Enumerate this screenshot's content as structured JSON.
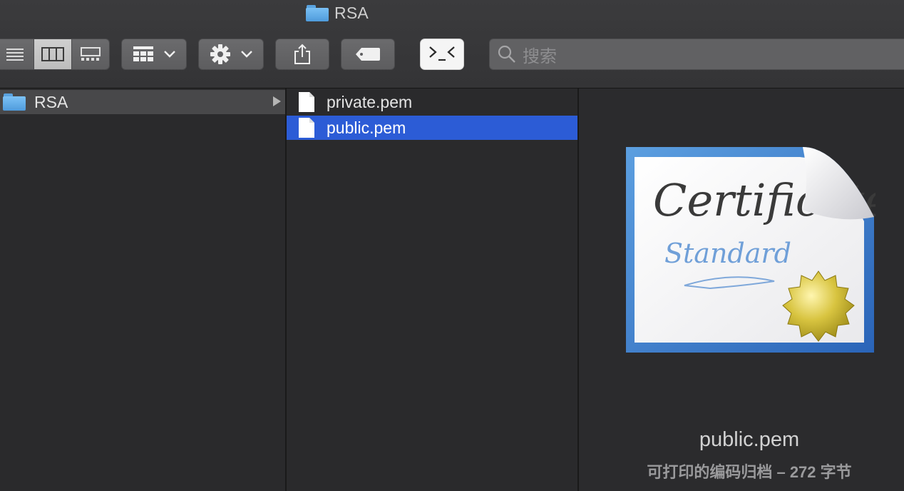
{
  "window": {
    "title": "RSA"
  },
  "toolbar": {
    "view_modes": [
      "list-view",
      "column-view",
      "gallery-view"
    ],
    "active_view": "column-view",
    "group_button": "group-by",
    "action_button": "action-menu",
    "share_button": "share",
    "tags_button": "tags",
    "terminal_button": "terminal",
    "search": {
      "placeholder": "搜索"
    }
  },
  "sidebar_column": {
    "items": [
      {
        "label": "RSA",
        "type": "folder",
        "selected": true,
        "has_children": true
      }
    ]
  },
  "files_column": {
    "items": [
      {
        "label": "private.pem",
        "type": "file",
        "selected": false
      },
      {
        "label": "public.pem",
        "type": "file",
        "selected": true
      }
    ]
  },
  "preview": {
    "file_name": "public.pem",
    "info": "可打印的编码归档 – 272 字节",
    "cert_title": "Certificate",
    "cert_subtitle": "Standard"
  },
  "colors": {
    "selection": "#2c5cd6",
    "folder": "#5aa3e0",
    "background": "#2b2b2d"
  }
}
